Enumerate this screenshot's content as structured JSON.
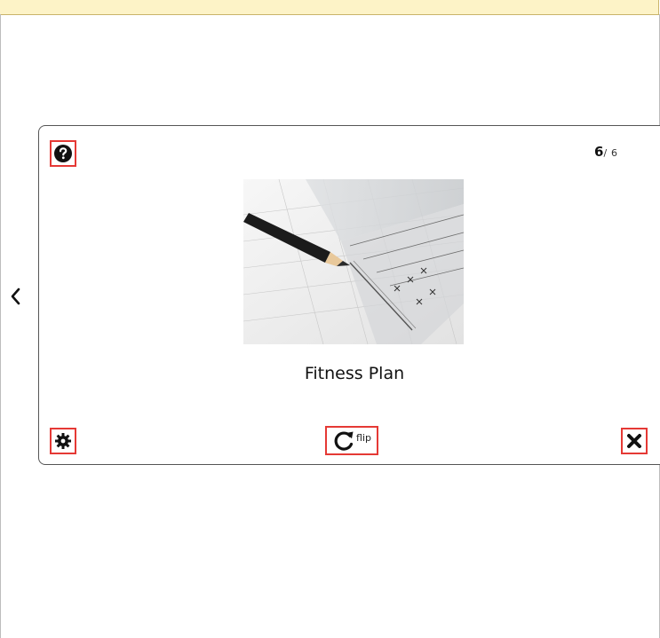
{
  "card": {
    "counter_current": "6",
    "counter_separator": "/",
    "counter_total": "6",
    "title": "Fitness Plan",
    "flip_label": "flip"
  },
  "icons": {
    "help": "question-circle-icon",
    "settings": "gear-icon",
    "flip": "rotate-icon",
    "close": "close-icon",
    "prev": "chevron-left-icon"
  },
  "colors": {
    "banner": "#fdf3c7",
    "highlight_border": "#e53935",
    "card_border": "#555555"
  }
}
